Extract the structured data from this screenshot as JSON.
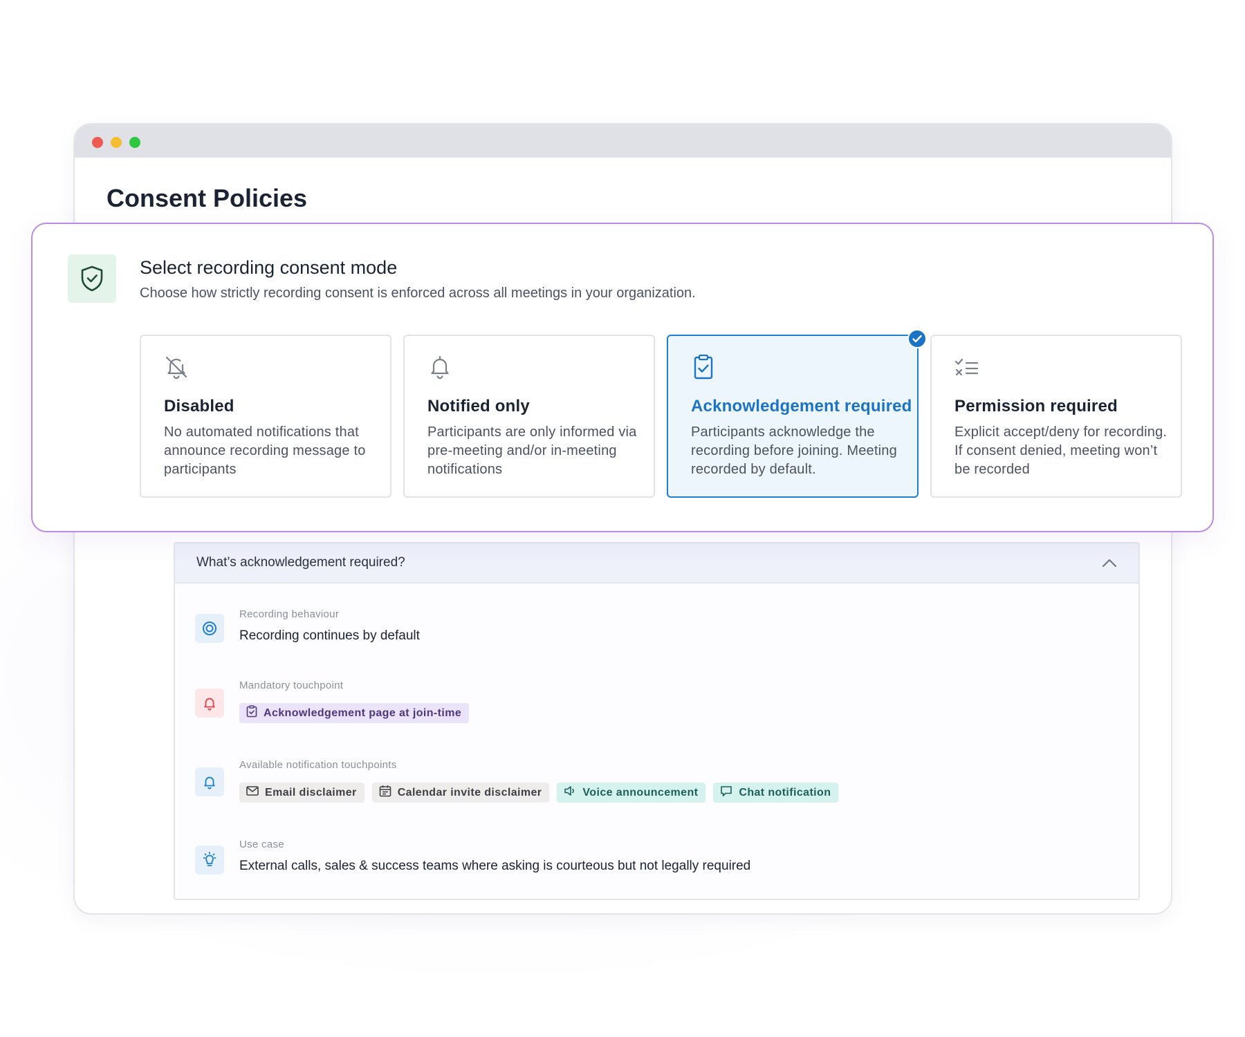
{
  "window": {
    "title": "Consent Policies"
  },
  "consent": {
    "title": "Select recording consent mode",
    "subtitle": "Choose how strictly recording consent is enforced across all meetings in your organization.",
    "icon": "shield-check-icon",
    "accent_color": "#b98be8",
    "modes": [
      {
        "title": "Disabled",
        "description": "No automated notifications that announce recording message to participants",
        "icon": "bell-off-icon",
        "selected": false
      },
      {
        "title": "Notified only",
        "description": "Participants are only informed via pre-meeting and/or in-meeting notifications",
        "icon": "bell-icon",
        "selected": false
      },
      {
        "title": "Acknowledgement required",
        "description": "Participants acknowledge the recording before joining. Meeting recorded by default.",
        "icon": "clipboard-check-icon",
        "selected": true
      },
      {
        "title": "Permission required",
        "description": "Explicit accept/deny for recording. If consent denied, meeting won’t be recorded",
        "icon": "checklist-icon",
        "selected": false
      }
    ],
    "selected_color": "#1a73c4"
  },
  "details": {
    "title": "What’s acknowledgement required?",
    "expanded": true,
    "recording_behaviour": {
      "label": "Recording behaviour",
      "value": "Recording continues by default",
      "icon": "record-icon"
    },
    "mandatory_touchpoint": {
      "label": "Mandatory touchpoint",
      "icon": "bell-alert-icon",
      "chip": {
        "label": "Acknowledgement page at join-time",
        "icon": "clipboard-check-icon"
      }
    },
    "available_touchpoints": {
      "label": "Available notification touchpoints",
      "icon": "bell-icon",
      "chips": [
        {
          "label": "Email disclaimer",
          "icon": "mail-icon"
        },
        {
          "label": "Calendar invite disclaimer",
          "icon": "calendar-icon"
        },
        {
          "label": "Voice announcement",
          "icon": "speaker-icon"
        },
        {
          "label": "Chat notification",
          "icon": "chat-icon"
        }
      ]
    },
    "use_case": {
      "label": "Use case",
      "value": "External calls, sales & success teams where asking is courteous but not legally required",
      "icon": "lightbulb-icon"
    }
  }
}
